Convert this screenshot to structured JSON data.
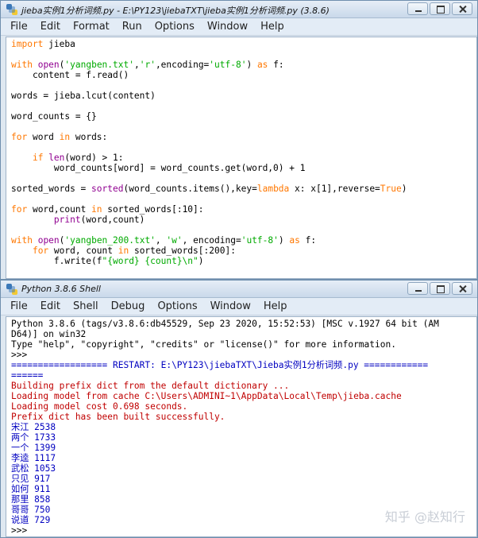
{
  "editor": {
    "title": "jieba实例1分析词频.py - E:\\PY123\\jiebaTXT\\jieba实例1分析词频.py (3.8.6)",
    "menu": [
      "File",
      "Edit",
      "Format",
      "Run",
      "Options",
      "Window",
      "Help"
    ]
  },
  "shell": {
    "title": "Python 3.8.6 Shell",
    "menu": [
      "File",
      "Edit",
      "Shell",
      "Debug",
      "Options",
      "Window",
      "Help"
    ]
  },
  "colors": {
    "keyword": "#ff7700",
    "builtin": "#900090",
    "string": "#00aa00",
    "error": "#c00000",
    "output": "#0000c0"
  },
  "watermark": "知乎 @赵知行"
}
